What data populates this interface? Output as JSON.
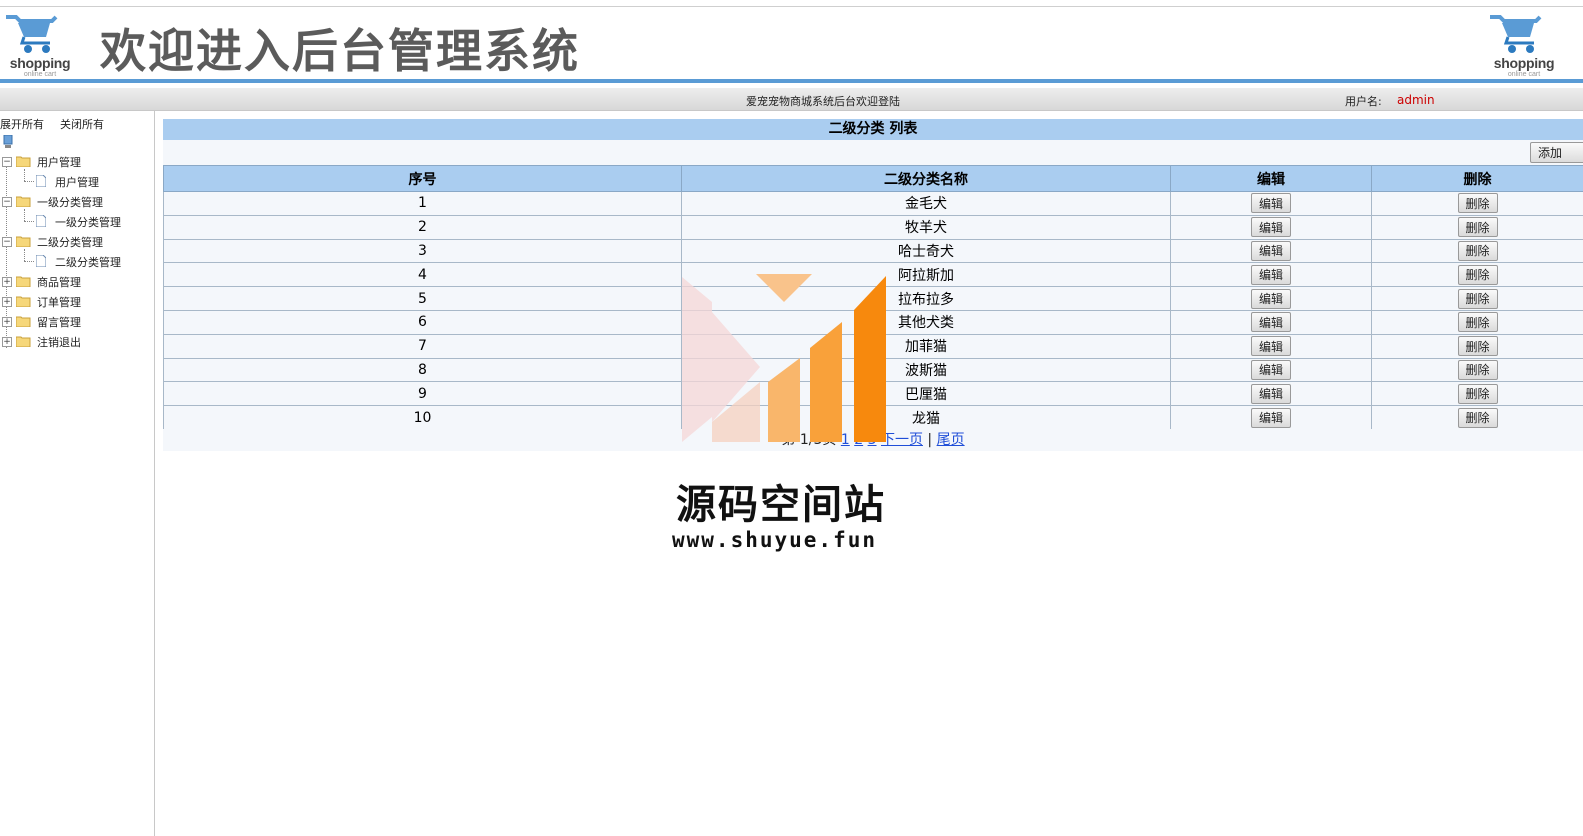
{
  "header": {
    "logo_text": "shopping",
    "logo_sub": "online cart",
    "title": "欢迎进入后台管理系统"
  },
  "info_bar": {
    "welcome": "爱宠宠物商城系统后台欢迎登陆",
    "user_label": "用户名:",
    "user_value": "admin"
  },
  "sidebar": {
    "expand_all": "展开所有",
    "collapse_all": "关闭所有",
    "groups": [
      {
        "label": "用户管理",
        "expanded": true,
        "child": "用户管理"
      },
      {
        "label": "一级分类管理",
        "expanded": true,
        "child": "一级分类管理"
      },
      {
        "label": "二级分类管理",
        "expanded": true,
        "child": "二级分类管理"
      },
      {
        "label": "商品管理",
        "expanded": false
      },
      {
        "label": "订单管理",
        "expanded": false
      },
      {
        "label": "留言管理",
        "expanded": false
      },
      {
        "label": "注销退出",
        "expanded": false
      }
    ]
  },
  "main": {
    "list_title": "二级分类 列表",
    "add_label": "添加",
    "columns": [
      "序号",
      "二级分类名称",
      "编辑",
      "删除"
    ],
    "edit_label": "编辑",
    "delete_label": "删除",
    "rows": [
      {
        "no": "1",
        "name": "金毛犬"
      },
      {
        "no": "2",
        "name": "牧羊犬"
      },
      {
        "no": "3",
        "name": "哈士奇犬"
      },
      {
        "no": "4",
        "name": "阿拉斯加"
      },
      {
        "no": "5",
        "name": "拉布拉多"
      },
      {
        "no": "6",
        "name": "其他犬类"
      },
      {
        "no": "7",
        "name": "加菲猫"
      },
      {
        "no": "8",
        "name": "波斯猫"
      },
      {
        "no": "9",
        "name": "巴厘猫"
      },
      {
        "no": "10",
        "name": "龙猫"
      }
    ],
    "pager": {
      "info": "第 1/3页",
      "page_1": "1",
      "page_2": "2",
      "page_3": "3",
      "next": "下一页",
      "separator": "|",
      "last": "尾页"
    }
  },
  "watermark": {
    "title": "源码空间站",
    "url": "www.shuyue.fun"
  },
  "colors": {
    "header_blue": "#5a9bd5",
    "table_header": "#aacdf0",
    "user_red": "#cc0000",
    "link_blue": "#1f4ed8",
    "watermark_orange": "#f7890d"
  }
}
